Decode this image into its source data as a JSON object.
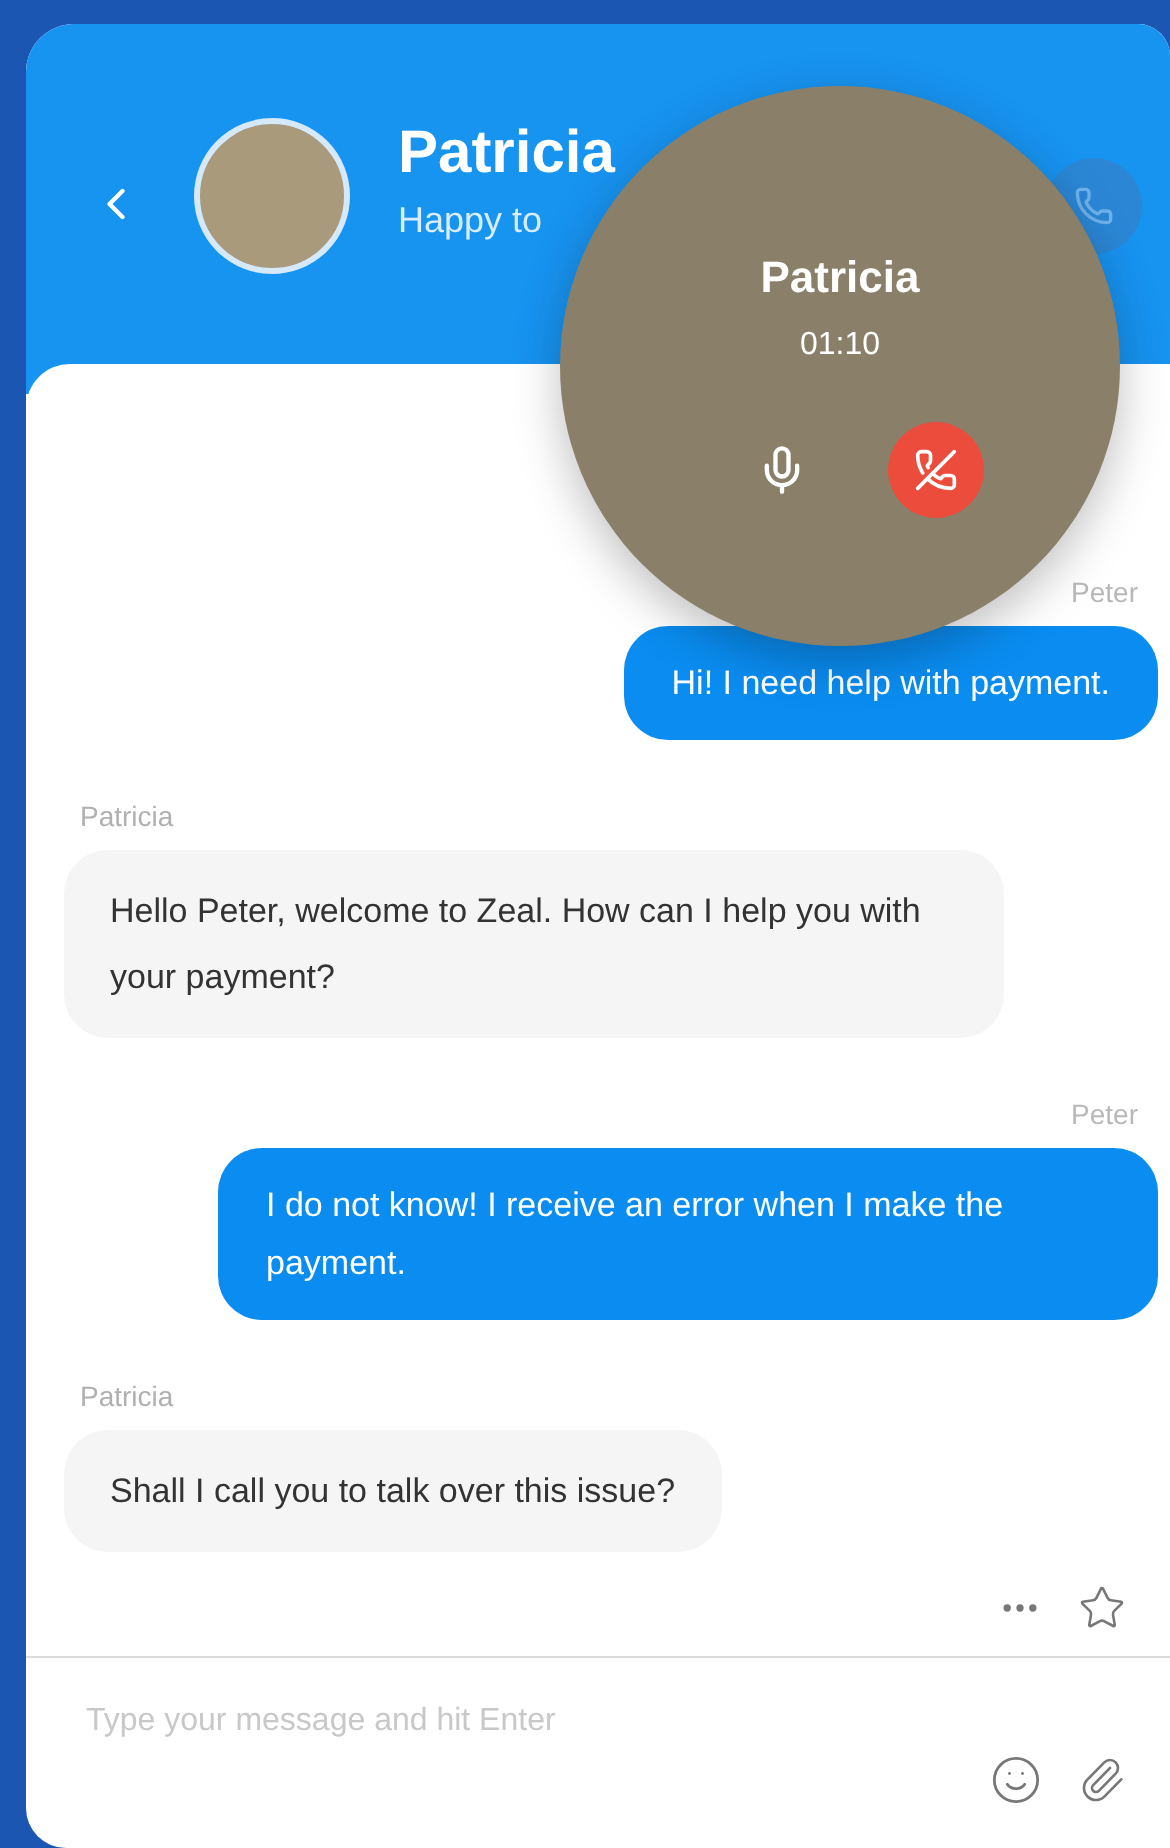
{
  "header": {
    "name": "Patricia",
    "status": "Happy to"
  },
  "call": {
    "name": "Patricia",
    "duration": "01:10"
  },
  "messages": [
    {
      "kind": "outgoing",
      "sender": "Peter",
      "text": "Hi! I need help with payment."
    },
    {
      "kind": "incoming",
      "sender": "Patricia",
      "text": "Hello Peter, welcome to Zeal. How can I help you with your payment?"
    },
    {
      "kind": "outgoing",
      "sender": "Peter",
      "text": "I do not know! I receive an error when I make the payment."
    },
    {
      "kind": "incoming",
      "sender": "Patricia",
      "text": "Shall I call you to talk over this issue?"
    }
  ],
  "composer": {
    "placeholder": "Type your message and hit Enter"
  }
}
